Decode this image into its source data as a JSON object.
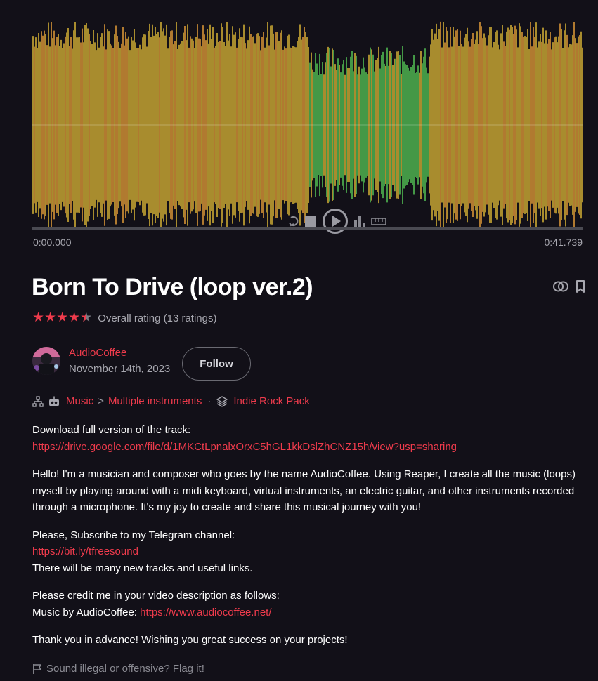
{
  "player": {
    "time_start": "0:00.000",
    "time_end": "0:41.739",
    "controls": [
      "loop-icon",
      "stop-icon",
      "play-icon",
      "spectrum-icon",
      "ruler-icon"
    ],
    "wave_colors": {
      "peak": "#e8c238",
      "mid": "#f5a83a",
      "quiet": "#5ad35a"
    }
  },
  "track": {
    "title": "Born To Drive (loop ver.2)",
    "rating_text": "Overall rating (13 ratings)",
    "rating_stars": 4.5,
    "actions": [
      "compare-icon",
      "bookmark-icon"
    ]
  },
  "author": {
    "name": "AudioCoffee",
    "date": "November 14th, 2023",
    "follow_label": "Follow"
  },
  "breadcrumbs": {
    "category": "Music",
    "separator": ">",
    "subcategory": "Multiple instruments",
    "dot": "·",
    "pack": "Indie Rock Pack"
  },
  "description": {
    "download_label": "Download full version of the track:",
    "download_link": "https://drive.google.com/file/d/1MKCtLpnalxOrxC5hGL1kkDslZhCNZ15h/view?usp=sharing",
    "intro": "Hello! I'm a musician and composer who goes by the name AudioCoffee. Using Reaper, I create all the music (loops) myself by playing around with a midi keyboard, virtual instruments, an electric guitar, and other instruments recorded through a microphone. It's my joy to create and share this musical journey with you!",
    "telegram_label": "Please, Subscribe to my Telegram channel:",
    "telegram_link": "https://bit.ly/tfreesound",
    "telegram_note": "There will be many new tracks and useful links.",
    "credit_label": "Please credit me in your video description as follows:",
    "credit_prefix": "Music by AudioCoffee: ",
    "credit_link": "https://www.audiocoffee.net/",
    "thanks": "Thank you in advance! Wishing you great success on your projects!"
  },
  "flag": {
    "text": "Sound illegal or offensive? Flag it!"
  },
  "accent_color": "#ef3b4c"
}
